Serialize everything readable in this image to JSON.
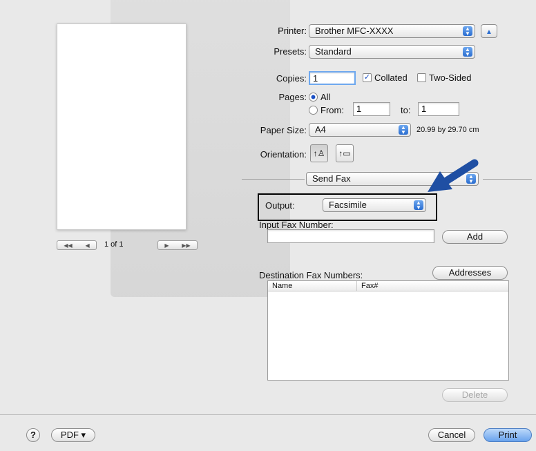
{
  "printer": {
    "label": "Printer:",
    "value": "Brother MFC-XXXX"
  },
  "presets": {
    "label": "Presets:",
    "value": "Standard"
  },
  "copies": {
    "label": "Copies:",
    "value": "1",
    "collated_label": "Collated",
    "collated_checked": true,
    "two_sided_label": "Two-Sided",
    "two_sided_checked": false
  },
  "pages": {
    "label": "Pages:",
    "all_label": "All",
    "from_label": "From:",
    "from_value": "1",
    "to_label": "to:",
    "to_value": "1"
  },
  "paper_size": {
    "label": "Paper Size:",
    "value": "A4",
    "dimensions": "20.99 by 29.70 cm"
  },
  "orientation": {
    "label": "Orientation:"
  },
  "panel": {
    "value": "Send Fax"
  },
  "output": {
    "label": "Output:",
    "value": "Facsimile"
  },
  "fax_input": {
    "label": "Input Fax Number:",
    "value": "",
    "add_label": "Add"
  },
  "destinations": {
    "label": "Destination Fax Numbers:",
    "addresses_label": "Addresses",
    "columns": [
      "Name",
      "Fax#"
    ],
    "rows": [],
    "delete_label": "Delete"
  },
  "preview": {
    "page_indicator": "1 of 1"
  },
  "footer": {
    "help_label": "?",
    "pdf_label": "PDF ▾",
    "cancel_label": "Cancel",
    "print_label": "Print"
  },
  "colors": {
    "accent": "#2a6dd0",
    "arrow": "#1f4fa3",
    "highlight_box": "#000000"
  }
}
